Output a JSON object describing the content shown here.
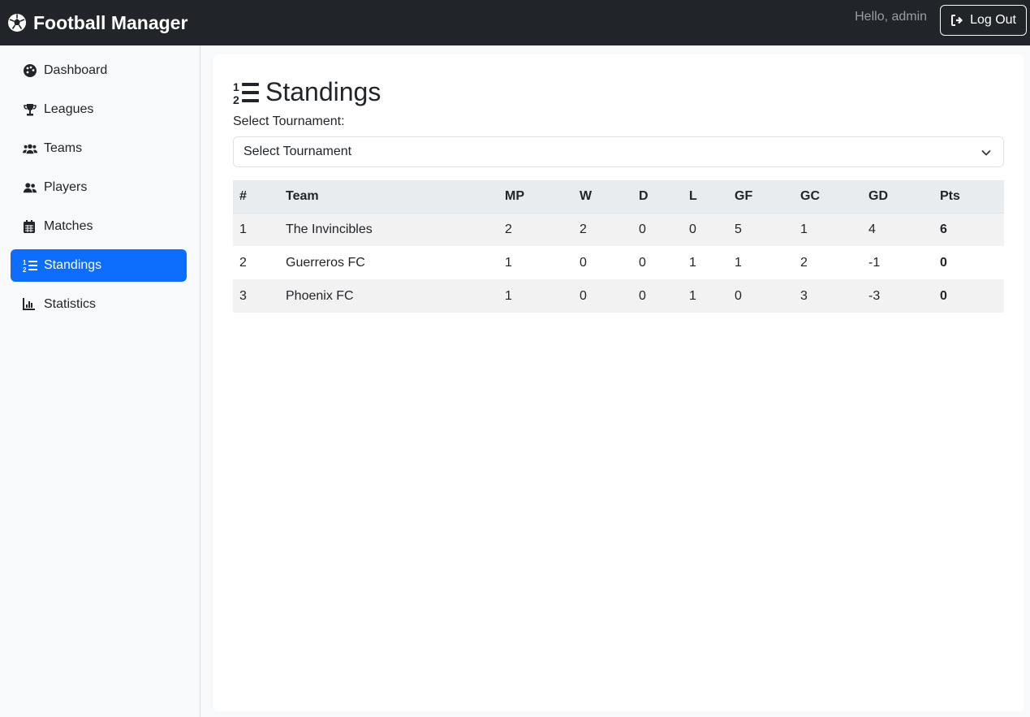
{
  "navbar": {
    "brand": "Football Manager",
    "greeting": "Hello, admin",
    "logout_label": "Log Out"
  },
  "sidebar": {
    "items": [
      {
        "label": "Dashboard",
        "icon": "palette-icon"
      },
      {
        "label": "Leagues",
        "icon": "trophy-icon"
      },
      {
        "label": "Teams",
        "icon": "users-icon"
      },
      {
        "label": "Players",
        "icon": "user-group-icon"
      },
      {
        "label": "Matches",
        "icon": "calendar-icon"
      },
      {
        "label": "Standings",
        "icon": "list-ol-icon",
        "active": true
      },
      {
        "label": "Statistics",
        "icon": "chart-bar-icon"
      }
    ]
  },
  "main": {
    "title": "Standings",
    "select_label": "Select Tournament:",
    "select_value": "Select Tournament",
    "table": {
      "headers": [
        "#",
        "Team",
        "MP",
        "W",
        "D",
        "L",
        "GF",
        "GC",
        "GD",
        "Pts"
      ],
      "rows": [
        [
          "1",
          "The Invincibles",
          "2",
          "2",
          "0",
          "0",
          "5",
          "1",
          "4",
          "6"
        ],
        [
          "2",
          "Guerreros FC",
          "1",
          "0",
          "0",
          "1",
          "1",
          "2",
          "-1",
          "0"
        ],
        [
          "3",
          "Phoenix FC",
          "1",
          "0",
          "0",
          "1",
          "0",
          "3",
          "-3",
          "0"
        ]
      ]
    }
  },
  "colors": {
    "navbar_bg": "#212529",
    "active_accent": "#0d6efd",
    "sidebar_bg": "#f8f9fa"
  }
}
